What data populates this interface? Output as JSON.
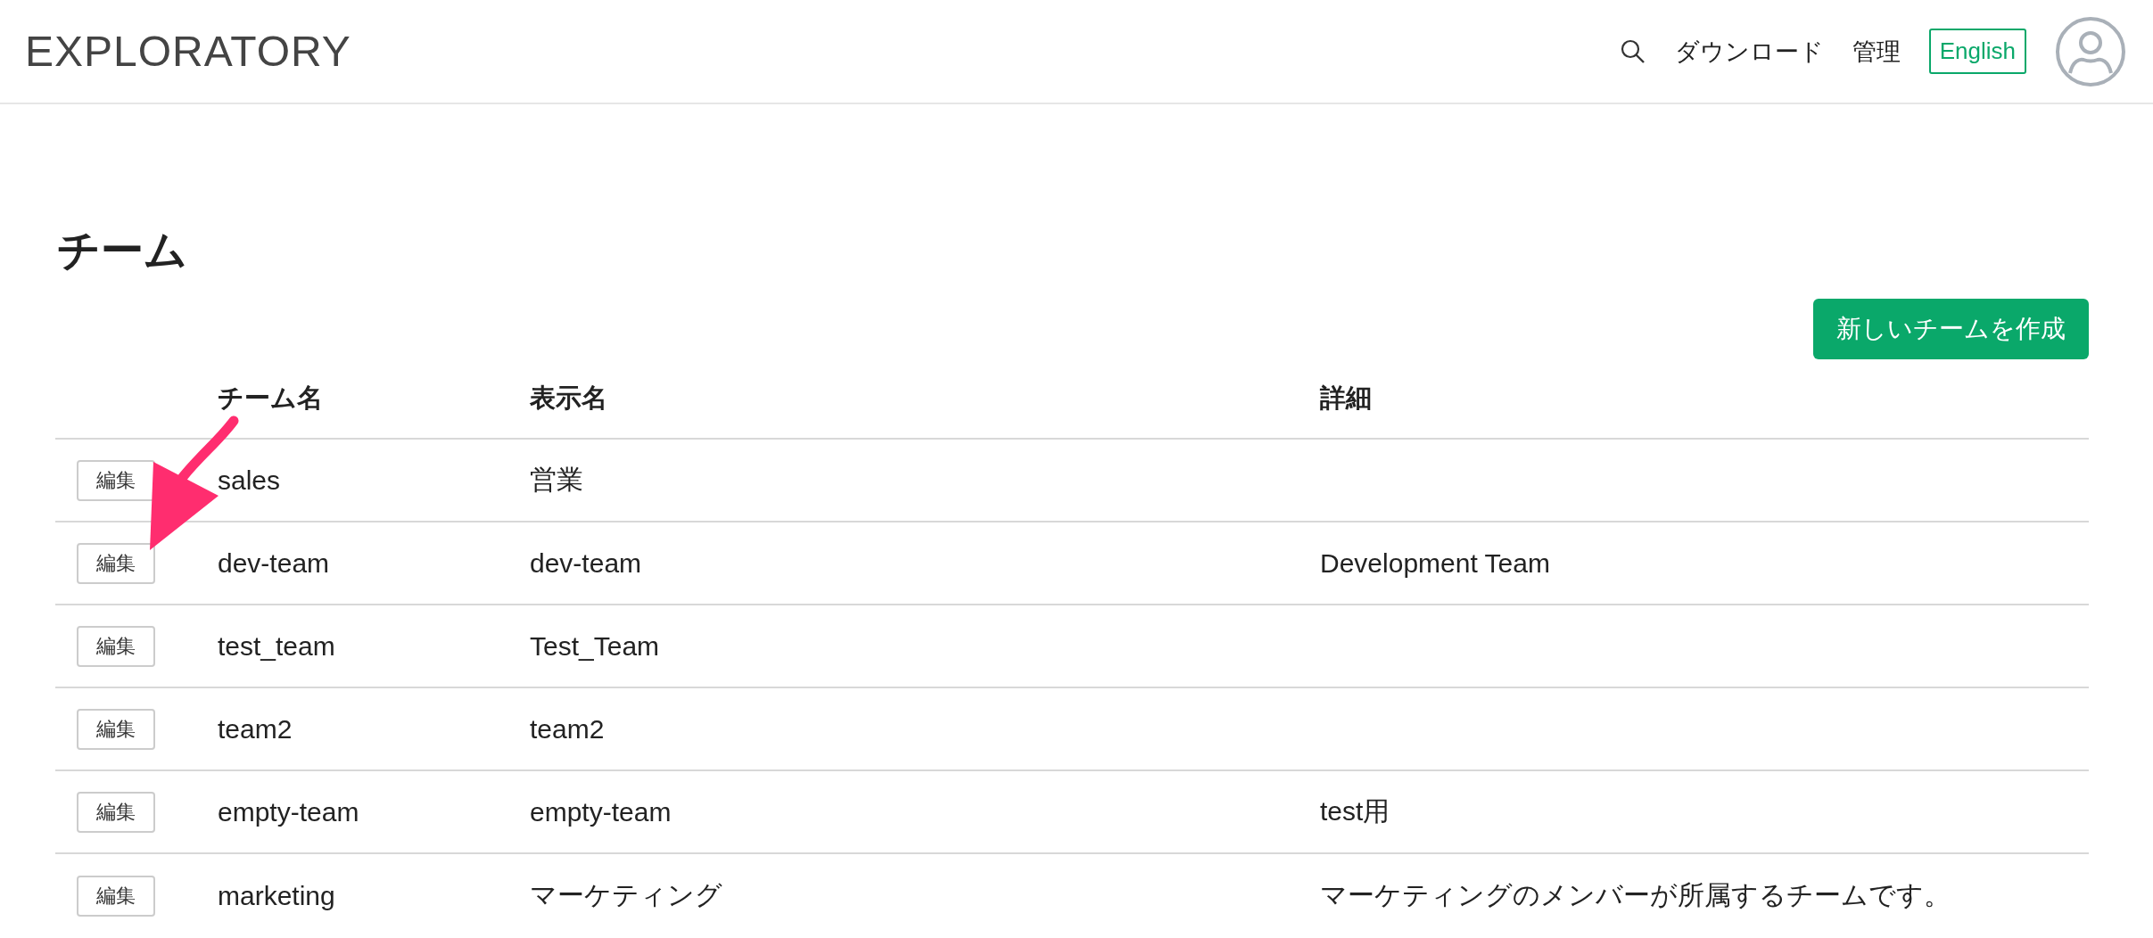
{
  "header": {
    "logo": "EXPLORATORY",
    "nav": [
      "ダウンロード",
      "管理"
    ],
    "language_button": "English"
  },
  "page": {
    "title": "チーム",
    "create_button": "新しいチームを作成"
  },
  "table": {
    "columns": [
      "チーム名",
      "表示名",
      "詳細"
    ],
    "rows": [
      {
        "edit": "編集",
        "name": "sales",
        "display_name": "営業",
        "details": ""
      },
      {
        "edit": "編集",
        "name": "dev-team",
        "display_name": "dev-team",
        "details": "Development Team"
      },
      {
        "edit": "編集",
        "name": "test_team",
        "display_name": "Test_Team",
        "details": ""
      },
      {
        "edit": "編集",
        "name": "team2",
        "display_name": "team2",
        "details": ""
      },
      {
        "edit": "編集",
        "name": "empty-team",
        "display_name": "empty-team",
        "details": "test用"
      },
      {
        "edit": "編集",
        "name": "marketing",
        "display_name": "マーケティング",
        "details": "マーケティングのメンバーが所属するチームです。"
      }
    ]
  }
}
